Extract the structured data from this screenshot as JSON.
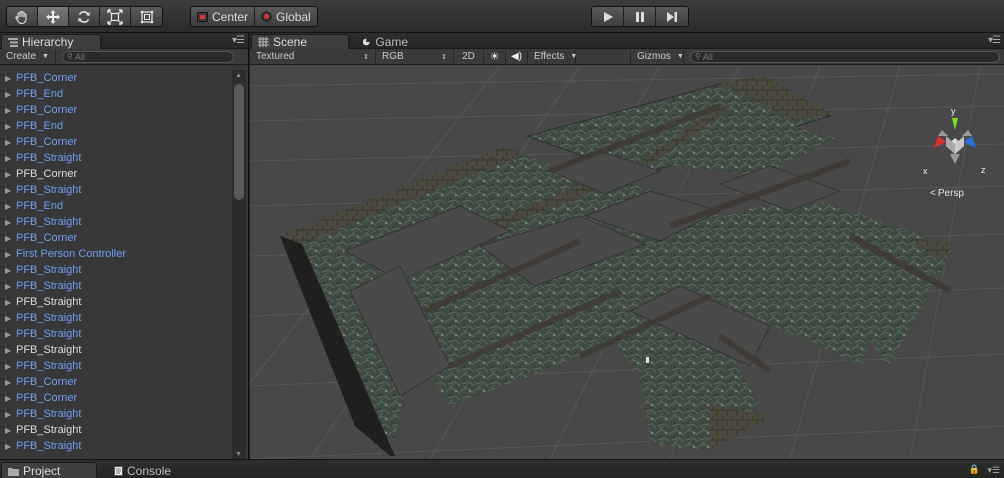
{
  "toolbar": {
    "tools": [
      {
        "name": "hand-tool",
        "icon": "hand-icon",
        "active": false
      },
      {
        "name": "move-tool",
        "icon": "move-arrows-icon",
        "active": true
      },
      {
        "name": "rotate-tool",
        "icon": "rotate-icon",
        "active": false
      },
      {
        "name": "scale-tool",
        "icon": "scale-icon",
        "active": false
      },
      {
        "name": "rect-tool",
        "icon": "rect-icon",
        "active": false
      }
    ],
    "pivot_label": "Center",
    "space_label": "Global"
  },
  "hierarchy": {
    "tab_label": "Hierarchy",
    "create_label": "Create",
    "search_placeholder": "All",
    "items": [
      {
        "label": "PFB_Corner",
        "prefab": true
      },
      {
        "label": "PFB_End",
        "prefab": true
      },
      {
        "label": "PFB_Corner",
        "prefab": true
      },
      {
        "label": "PFB_End",
        "prefab": true
      },
      {
        "label": "PFB_Corner",
        "prefab": true
      },
      {
        "label": "PFB_Straight",
        "prefab": true
      },
      {
        "label": "PFB_Corner",
        "prefab": false
      },
      {
        "label": "PFB_Straight",
        "prefab": true
      },
      {
        "label": "PFB_End",
        "prefab": true
      },
      {
        "label": "PFB_Straight",
        "prefab": true
      },
      {
        "label": "PFB_Corner",
        "prefab": true
      },
      {
        "label": "First Person Controller",
        "prefab": true
      },
      {
        "label": "PFB_Straight",
        "prefab": true
      },
      {
        "label": "PFB_Straight",
        "prefab": true
      },
      {
        "label": "PFB_Straight",
        "prefab": false
      },
      {
        "label": "PFB_Straight",
        "prefab": true
      },
      {
        "label": "PFB_Straight",
        "prefab": true
      },
      {
        "label": "PFB_Straight",
        "prefab": false
      },
      {
        "label": "PFB_Straight",
        "prefab": true
      },
      {
        "label": "PFB_Corner",
        "prefab": true
      },
      {
        "label": "PFB_Corner",
        "prefab": true
      },
      {
        "label": "PFB_Straight",
        "prefab": true
      },
      {
        "label": "PFB_Straight",
        "prefab": false
      },
      {
        "label": "PFB_Straight",
        "prefab": true
      }
    ]
  },
  "scene": {
    "scene_tab": "Scene",
    "game_tab": "Game",
    "render_mode": "Textured",
    "color_mode": "RGB",
    "mode_2d": "2D",
    "effects_label": "Effects",
    "gizmos_label": "Gizmos",
    "search_placeholder": "All",
    "gizmo": {
      "y": "y",
      "x": "x",
      "z": "z",
      "projection": "Persp"
    }
  },
  "bottom": {
    "project_tab": "Project",
    "console_tab": "Console"
  },
  "colors": {
    "prefab_text": "#6f9ef5",
    "plain_text": "#dcdcdc",
    "gizmo_y": "#7de02a",
    "gizmo_x": "#e0302a",
    "gizmo_z": "#2a6fe0"
  }
}
